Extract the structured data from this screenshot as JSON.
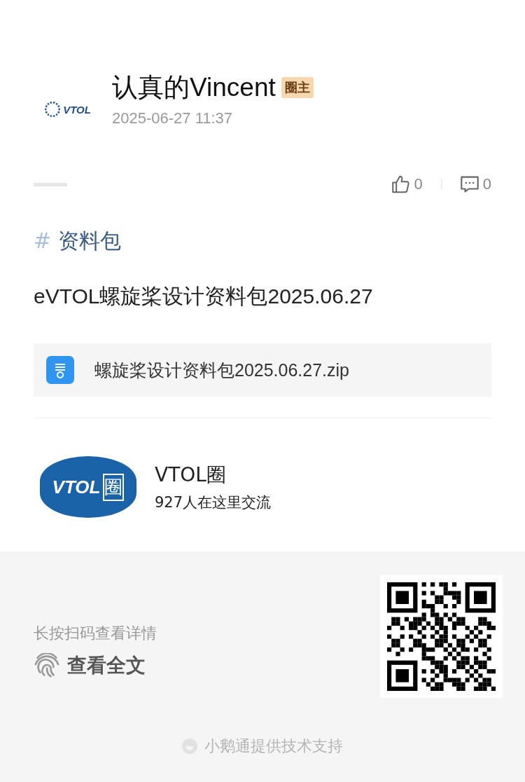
{
  "author": {
    "avatar_logo_text": "VTOL",
    "name": "认真的Vincent",
    "badge": "圈主",
    "time": "2025-06-27 11:37"
  },
  "stats": {
    "likes": "0",
    "comments": "0"
  },
  "topic": {
    "hash": "#",
    "name": "资料包"
  },
  "content": "eVTOL螺旋桨设计资料包2025.06.27",
  "attachment": {
    "file_name": "螺旋桨设计资料包2025.06.27.zip"
  },
  "group": {
    "logo_text": "VTOL",
    "logo_mark": "圈",
    "name": "VTOL圈",
    "members": "927人在这里交流"
  },
  "share": {
    "hint": "长按扫码查看详情",
    "action": "查看全文"
  },
  "footer": {
    "credit": "小鹅通提供技术支持"
  }
}
